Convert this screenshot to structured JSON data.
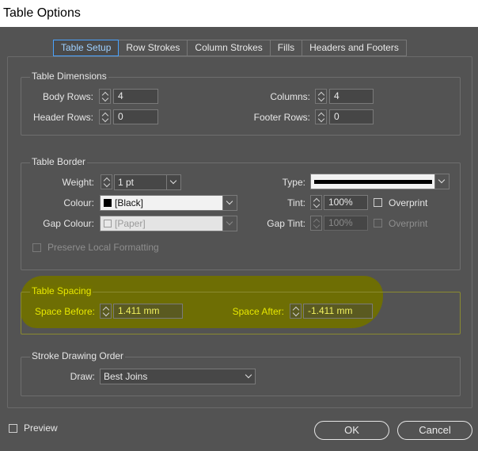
{
  "window": {
    "title": "Table Options"
  },
  "tabs": [
    {
      "label": "Table Setup",
      "active": true
    },
    {
      "label": "Row Strokes",
      "active": false
    },
    {
      "label": "Column Strokes",
      "active": false
    },
    {
      "label": "Fills",
      "active": false
    },
    {
      "label": "Headers and Footers",
      "active": false
    }
  ],
  "dimensions": {
    "title": "Table Dimensions",
    "body_rows_label": "Body Rows:",
    "body_rows": "4",
    "header_rows_label": "Header Rows:",
    "header_rows": "0",
    "columns_label": "Columns:",
    "columns": "4",
    "footer_rows_label": "Footer Rows:",
    "footer_rows": "0"
  },
  "border": {
    "title": "Table Border",
    "weight_label": "Weight:",
    "weight": "1 pt",
    "colour_label": "Colour:",
    "colour": "[Black]",
    "gap_colour_label": "Gap Colour:",
    "gap_colour": "[Paper]",
    "preserve_label": "Preserve Local Formatting",
    "type_label": "Type:",
    "tint_label": "Tint:",
    "tint": "100%",
    "overprint_label": "Overprint",
    "gap_tint_label": "Gap Tint:",
    "gap_tint": "100%",
    "gap_overprint_label": "Overprint"
  },
  "spacing": {
    "title": "Table Spacing",
    "before_label": "Space Before:",
    "before": "1.411 mm",
    "after_label": "Space After:",
    "after": "-1.411 mm"
  },
  "order": {
    "title": "Stroke Drawing Order",
    "draw_label": "Draw:",
    "draw": "Best Joins"
  },
  "footer": {
    "preview_label": "Preview",
    "ok_label": "OK",
    "cancel_label": "Cancel"
  },
  "colors": {
    "background": "#535353",
    "highlight": "#707000",
    "highlight_text": "#e8e800",
    "active_tab": "#4aa3ff"
  }
}
